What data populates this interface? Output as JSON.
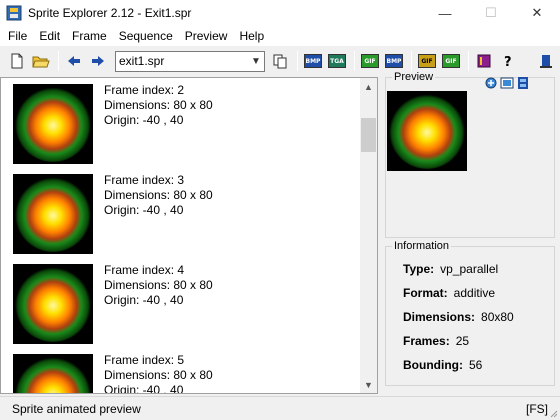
{
  "window": {
    "title": "Sprite Explorer 2.12 - Exit1.spr",
    "minimize": "—",
    "maximize": "☐",
    "close": "✕"
  },
  "menu": [
    "File",
    "Edit",
    "Frame",
    "Sequence",
    "Preview",
    "Help"
  ],
  "toolbar": {
    "file_combo_value": "exit1.spr",
    "buttons": [
      "new-file",
      "open-folder",
      "back-arrow",
      "forward-arrow",
      "copy",
      "export-bmp",
      "export-tga",
      "export-gif",
      "export-bmp-alt",
      "import-gif",
      "export-gif-alt",
      "help-book",
      "help-question",
      "exit"
    ]
  },
  "frames": [
    {
      "index_label": "Frame index: 2",
      "dimensions": "Dimensions: 80 x 80",
      "origin": "Origin: -40 , 40"
    },
    {
      "index_label": "Frame index: 3",
      "dimensions": "Dimensions: 80 x 80",
      "origin": "Origin: -40 , 40"
    },
    {
      "index_label": "Frame index: 4",
      "dimensions": "Dimensions: 80 x 80",
      "origin": "Origin: -40 , 40"
    },
    {
      "index_label": "Frame index: 5",
      "dimensions": "Dimensions: 80 x 80",
      "origin": "Origin: -40 , 40"
    }
  ],
  "preview": {
    "title": "Preview"
  },
  "info": {
    "title": "Information",
    "rows": [
      {
        "label": "Type:",
        "value": "vp_parallel"
      },
      {
        "label": "Format:",
        "value": "additive"
      },
      {
        "label": "Dimensions:",
        "value": "80x80"
      },
      {
        "label": "Frames:",
        "value": "25"
      },
      {
        "label": "Bounding:",
        "value": "56"
      }
    ]
  },
  "status": {
    "text": "Sprite animated preview",
    "mode": "[FS]"
  },
  "colors": {
    "sprite_core": "#ffe000",
    "sprite_mid": "#ff8000",
    "sprite_outer": "#1a8a1a"
  }
}
